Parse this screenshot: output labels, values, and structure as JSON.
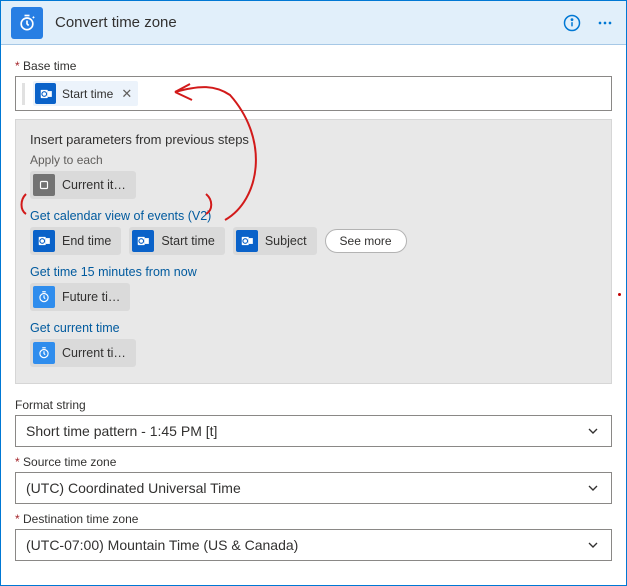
{
  "header": {
    "title": "Convert time zone"
  },
  "fields": {
    "base_time": {
      "label": "Base time",
      "token": "Start time"
    },
    "format_string": {
      "label": "Format string",
      "value": "Short time pattern - 1:45 PM [t]"
    },
    "source_tz": {
      "label": "Source time zone",
      "value": "(UTC) Coordinated Universal Time"
    },
    "dest_tz": {
      "label": "Destination time zone",
      "value": "(UTC-07:00) Mountain Time (US & Canada)"
    }
  },
  "params": {
    "title": "Insert parameters from previous steps",
    "apply_to_each": {
      "label": "Apply to each",
      "chip": "Current it…"
    },
    "calendar": {
      "label": "Get calendar view of events (V2)",
      "chips": [
        "End time",
        "Start time",
        "Subject"
      ],
      "see_more": "See more"
    },
    "future": {
      "label": "Get time 15 minutes from now",
      "chip": "Future ti…"
    },
    "current": {
      "label": "Get current time",
      "chip": "Current ti…"
    }
  }
}
